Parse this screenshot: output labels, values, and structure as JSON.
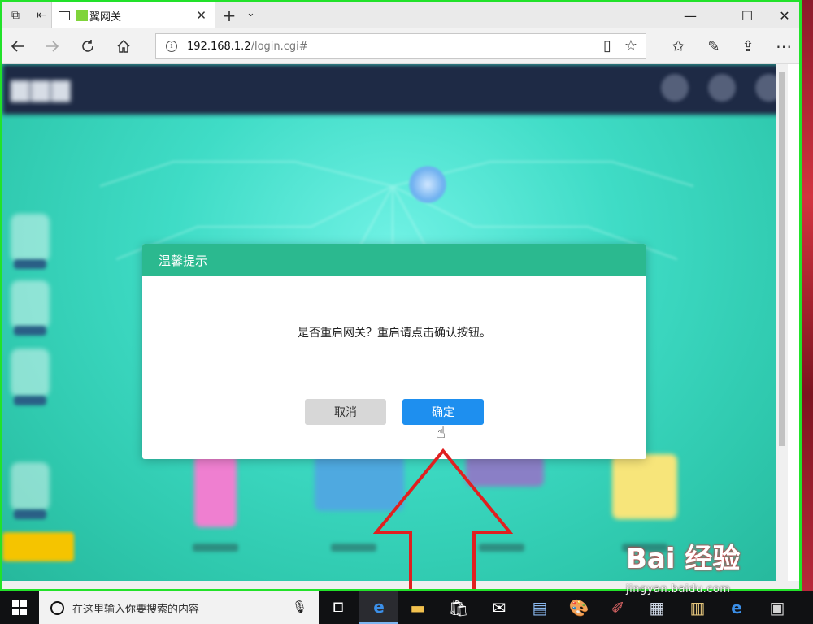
{
  "browser": {
    "tab_title": "翼网关",
    "url_host": "192.168.1.2",
    "url_path": "/login.cgi#"
  },
  "dialog": {
    "title": "温馨提示",
    "message": "是否重启网关？重启请点击确认按钮。",
    "cancel_label": "取消",
    "ok_label": "确定"
  },
  "taskbar": {
    "search_placeholder": "在这里输入你要搜索的内容"
  },
  "watermark": {
    "text": "Bai 经验",
    "url": "jingyan.baidu.com"
  },
  "colors": {
    "dialog_header": "#2bb98f",
    "ok_button": "#1e8fef",
    "arrow": "#e02020",
    "frame_border": "#22e22a"
  },
  "icons": {
    "back": "arrow-left-icon",
    "forward": "arrow-right-icon",
    "refresh": "refresh-icon",
    "home": "home-icon",
    "favorites": "star-icon",
    "reading": "book-icon"
  }
}
